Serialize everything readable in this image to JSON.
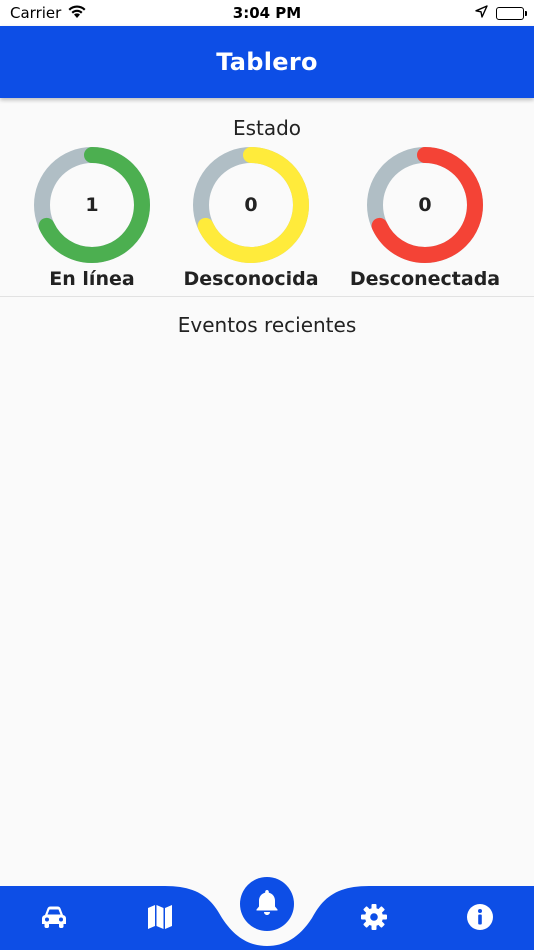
{
  "status_bar": {
    "carrier": "Carrier",
    "time": "3:04 PM"
  },
  "app_bar": {
    "title": "Tablero"
  },
  "status_section": {
    "title": "Estado",
    "gauges": [
      {
        "label": "En línea",
        "value": "1",
        "color": "#4caf50"
      },
      {
        "label": "Desconocida",
        "value": "0",
        "color": "#ffeb3b"
      },
      {
        "label": "Desconectada",
        "value": "0",
        "color": "#f44336"
      }
    ],
    "track_color": "#b0bec5"
  },
  "events_section": {
    "title": "Eventos recientes"
  },
  "bottom_nav": {
    "items": [
      {
        "icon": "car-icon"
      },
      {
        "icon": "map-icon"
      },
      {
        "icon": "bell-icon",
        "active": true
      },
      {
        "icon": "gear-icon"
      },
      {
        "icon": "info-icon"
      }
    ],
    "color": "#0d4ee6"
  }
}
